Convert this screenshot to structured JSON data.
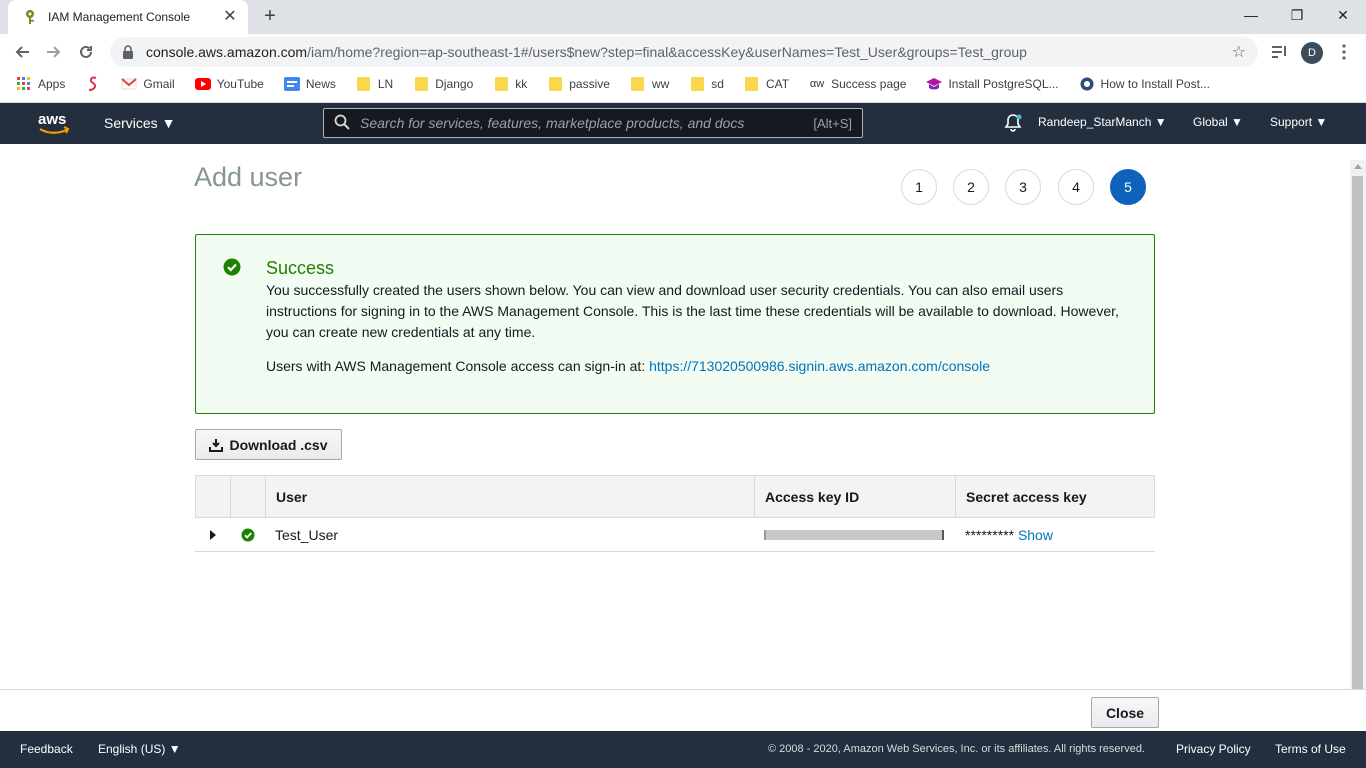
{
  "browser": {
    "tab_title": "IAM Management Console",
    "url_domain": "console.aws.amazon.com",
    "url_path": "/iam/home?region=ap-southeast-1#/users$new?step=final&accessKey&userNames=Test_User&groups=Test_group",
    "profile_initial": "D",
    "bookmarks": [
      "Apps",
      "Gmail",
      "YouTube",
      "News",
      "LN",
      "Django",
      "kk",
      "passive",
      "ww",
      "sd",
      "CAT",
      "Success page",
      "Install PostgreSQL...",
      "How to Install Post..."
    ]
  },
  "aws_header": {
    "services_label": "Services",
    "search_placeholder": "Search for services, features, marketplace products, and docs",
    "search_shortcut": "[Alt+S]",
    "account": "Randeep_StarManch",
    "region": "Global",
    "support": "Support"
  },
  "page": {
    "title": "Add user",
    "steps": [
      "1",
      "2",
      "3",
      "4",
      "5"
    ],
    "active_step": "5"
  },
  "success": {
    "title": "Success",
    "message": "You successfully created the users shown below. You can view and download user security credentials. You can also email users instructions for signing in to the AWS Management Console. This is the last time these credentials will be available to download. However, you can create new credentials at any time.",
    "signin_prefix": "Users with AWS Management Console access can sign-in at: ",
    "signin_url": "https://713020500986.signin.aws.amazon.com/console"
  },
  "download_label": "Download .csv",
  "table": {
    "headers": [
      "User",
      "Access key ID",
      "Secret access key"
    ],
    "rows": [
      {
        "user": "Test_User",
        "secret_mask": "*********",
        "show_label": "Show"
      }
    ]
  },
  "close_label": "Close",
  "footer": {
    "feedback": "Feedback",
    "language": "English (US)",
    "copyright": "© 2008 - 2020, Amazon Web Services, Inc. or its affiliates. All rights reserved.",
    "privacy": "Privacy Policy",
    "terms": "Terms of Use"
  },
  "colors": {
    "aws_nav": "#232f3e",
    "success_green": "#1d8102",
    "link_blue": "#0073bb",
    "active_step": "#0f62ba"
  }
}
